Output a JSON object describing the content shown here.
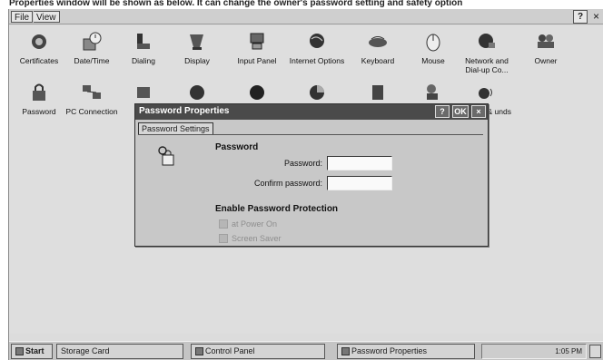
{
  "caption": "Properties window will be shown as below. It can change the owner's password setting and safety option",
  "menubar": {
    "file": "File",
    "view": "View",
    "help": "?",
    "close": "×"
  },
  "control_panel": {
    "row1": [
      {
        "label": "Certificates",
        "icon": "certificates-icon"
      },
      {
        "label": "Date/Time",
        "icon": "date-time-icon"
      },
      {
        "label": "Dialing",
        "icon": "dialing-icon"
      },
      {
        "label": "Display",
        "icon": "display-icon"
      },
      {
        "label": "Input Panel",
        "icon": "input-panel-icon"
      },
      {
        "label": "Internet Options",
        "icon": "internet-options-icon"
      },
      {
        "label": "Keyboard",
        "icon": "keyboard-icon"
      },
      {
        "label": "Mouse",
        "icon": "mouse-icon"
      },
      {
        "label": "Network and Dial-up Co...",
        "icon": "network-icon"
      },
      {
        "label": "Owner",
        "icon": "owner-icon"
      }
    ],
    "row2": [
      {
        "label": "Password",
        "icon": "password-icon"
      },
      {
        "label": "PC Connection",
        "icon": "pc-connection-icon"
      },
      {
        "label": "me & unds",
        "icon": "volume-sounds-icon"
      }
    ]
  },
  "dialog": {
    "title": "Password Properties",
    "help": "?",
    "ok": "OK",
    "close": "×",
    "tab": "Password Settings",
    "section_password": "Password",
    "password_label": "Password:",
    "password_value": "",
    "confirm_label": "Confirm password:",
    "confirm_value": "",
    "section_protection": "Enable Password Protection",
    "option_power_on": "at Power On",
    "option_screen_saver": "Screen Saver"
  },
  "taskbar": {
    "start": "Start",
    "storage": "Storage Card",
    "control_panel": "Control Panel",
    "password_props": "Password Properties",
    "clock": "1:05 PM"
  }
}
